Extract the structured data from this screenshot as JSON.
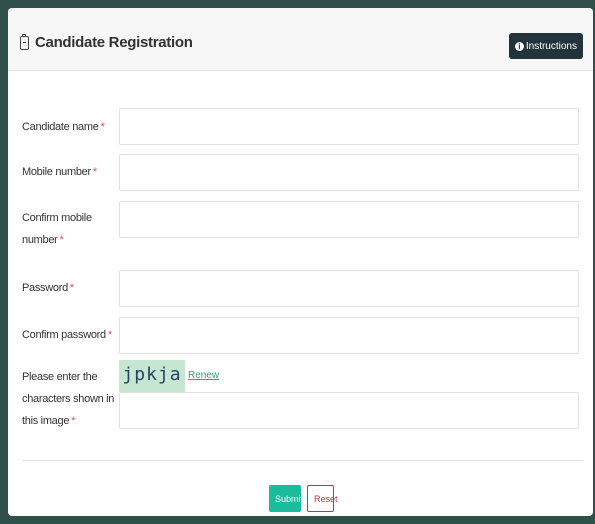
{
  "header": {
    "title": "Candidate Registration",
    "instructions_label": "Instructions",
    "info_glyph": "i"
  },
  "form": {
    "required_marker": "*",
    "fields": [
      {
        "label_line1": "Candidate name",
        "label_line2": ""
      },
      {
        "label_line1": "Mobile number",
        "label_line2": ""
      },
      {
        "label_line1": "Confirm mobile",
        "label_line2": "number"
      },
      {
        "label_line1": "Password",
        "label_line2": ""
      },
      {
        "label_line1": "Confirm password",
        "label_line2": ""
      },
      {
        "label_line1": "Please enter the",
        "label_line2": "characters shown in",
        "label_line3": "this image"
      }
    ],
    "captcha_text": "jpkja",
    "renew_label": "Renew"
  },
  "actions": {
    "submit_label": "Submit",
    "reset_label": "Reset"
  },
  "colors": {
    "accent": "#1abc9c",
    "required": "#d9534f",
    "instructions_bg": "#22333b",
    "page_bg": "#2f4f4a"
  }
}
